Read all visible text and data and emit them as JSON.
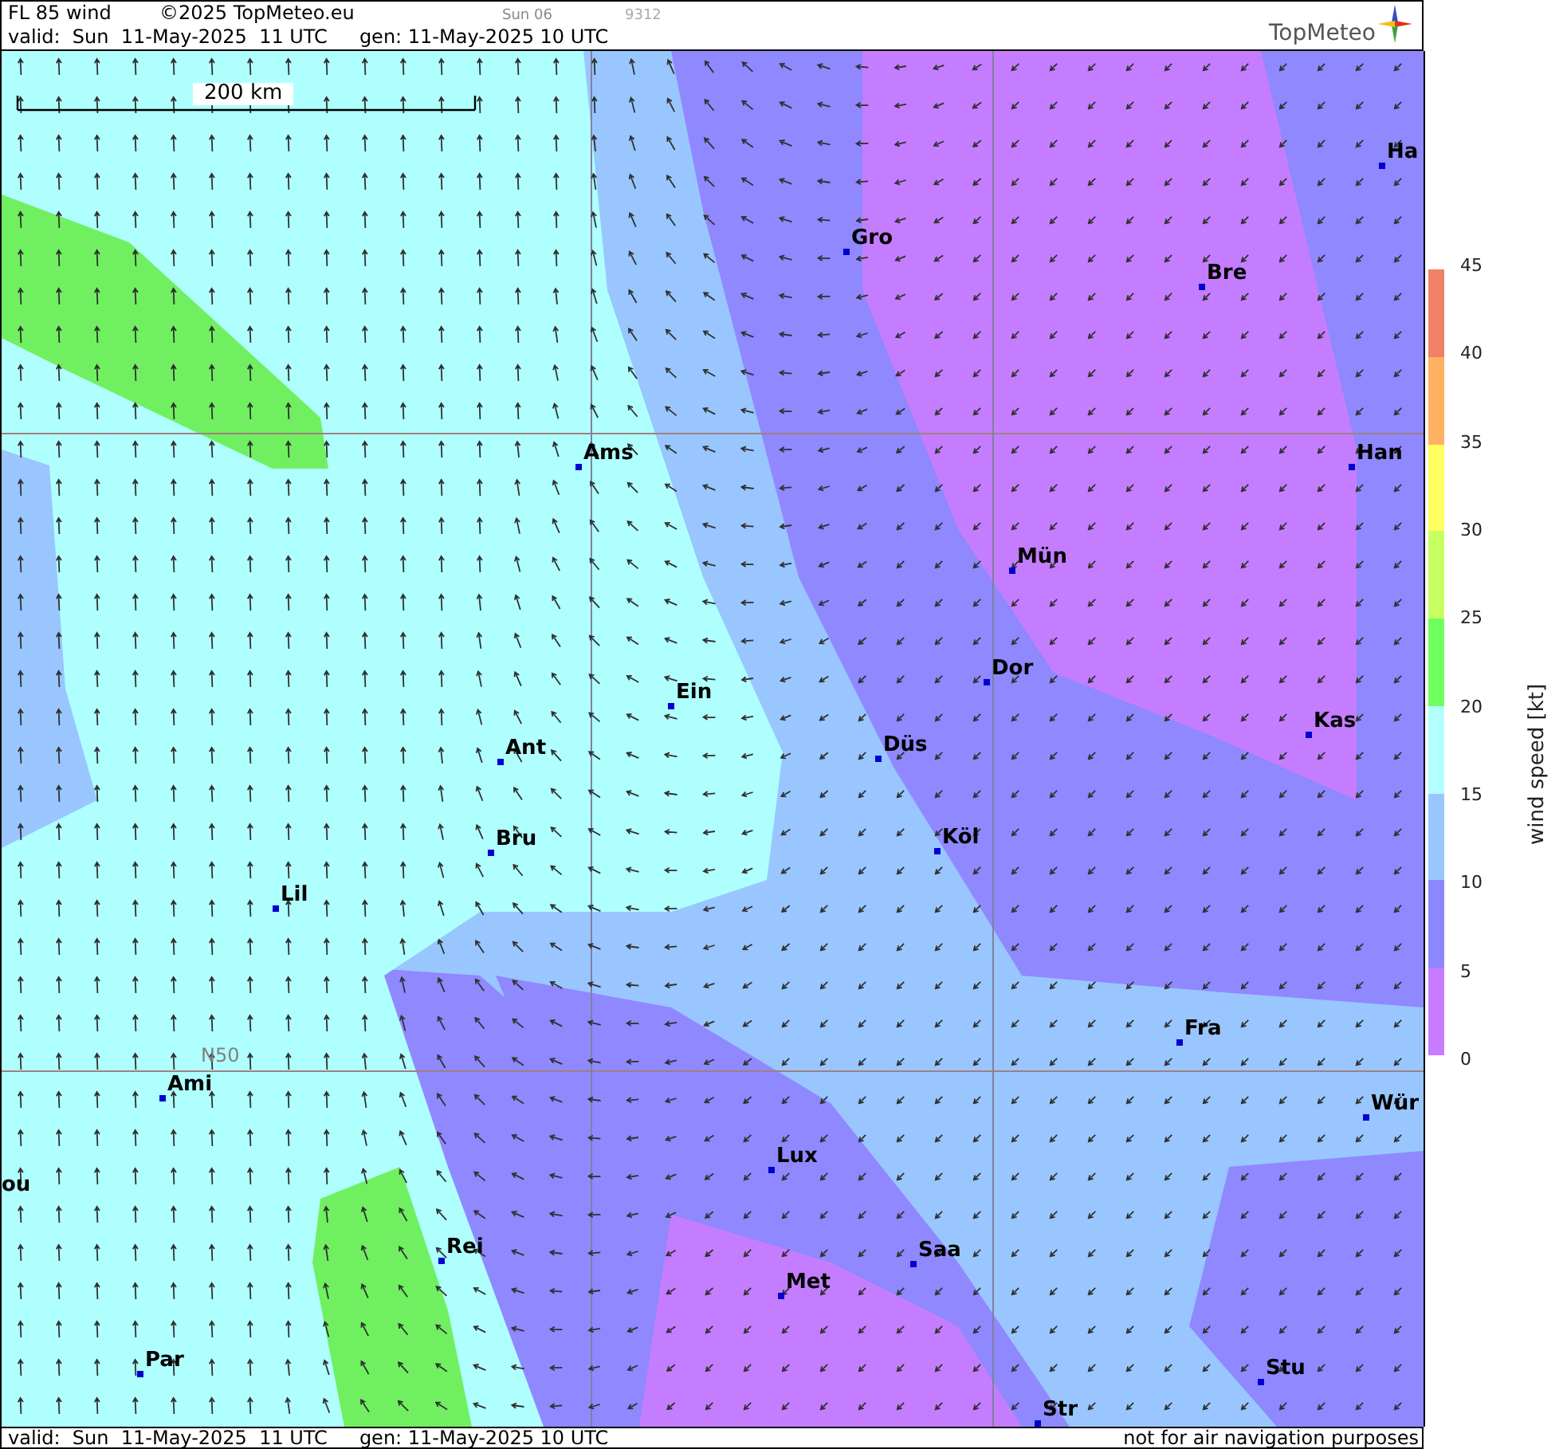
{
  "header": {
    "title": "FL 85 wind",
    "copyright": "©2025 TopMeteo.eu",
    "day_code": "Sun 06",
    "run_code": "9312",
    "valid": "valid:  Sun  11-May-2025  11 UTC",
    "generated": "gen: 11-May-2025 10 UTC",
    "logo": "TopMeteo"
  },
  "map": {
    "scale": "200 km",
    "grid_label": "N50",
    "cities": [
      {
        "name": "Ha"
      },
      {
        "name": "Gro"
      },
      {
        "name": "Bre"
      },
      {
        "name": "Ams"
      },
      {
        "name": "Han"
      },
      {
        "name": "Mün"
      },
      {
        "name": "Dor"
      },
      {
        "name": "Ein"
      },
      {
        "name": "Kas"
      },
      {
        "name": "Ant"
      },
      {
        "name": "Düs"
      },
      {
        "name": "Köl"
      },
      {
        "name": "Bru"
      },
      {
        "name": "Lil"
      },
      {
        "name": "Fra"
      },
      {
        "name": "Ami"
      },
      {
        "name": "Wür"
      },
      {
        "name": "Lux"
      },
      {
        "name": "ou"
      },
      {
        "name": "Rei"
      },
      {
        "name": "Saa"
      },
      {
        "name": "Met"
      },
      {
        "name": "Par"
      },
      {
        "name": "Stu"
      },
      {
        "name": "Str"
      }
    ]
  },
  "legend": {
    "title": "wind speed [kt]",
    "ticks": [
      "45",
      "40",
      "35",
      "30",
      "25",
      "20",
      "15",
      "10",
      "5",
      "0"
    ],
    "bands": [
      {
        "color": "#f08068"
      },
      {
        "color": "#ffb060"
      },
      {
        "color": "#ffff60"
      },
      {
        "color": "#c8ff60"
      },
      {
        "color": "#70ff60"
      },
      {
        "color": "#b2ffff"
      },
      {
        "color": "#99c6ff"
      },
      {
        "color": "#8c86ff"
      },
      {
        "color": "#c87cff"
      }
    ]
  },
  "footer": {
    "valid": "valid:  Sun  11-May-2025  11 UTC",
    "generated": "gen: 11-May-2025 10 UTC",
    "disclaimer": "not for air navigation purposes"
  }
}
